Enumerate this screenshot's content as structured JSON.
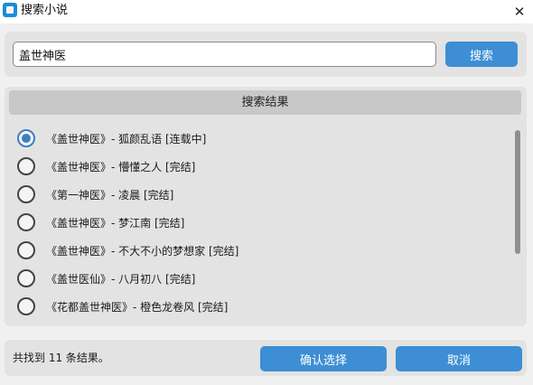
{
  "window": {
    "title": "搜索小说",
    "close_icon": "close-icon"
  },
  "search": {
    "value": "盖世神医",
    "button_label": "搜索"
  },
  "results": {
    "header": "搜索结果",
    "items": [
      {
        "label": "《盖世神医》- 狐颜乱语 [连载中]",
        "selected": true
      },
      {
        "label": "《盖世神医》- 懵懂之人 [完结]",
        "selected": false
      },
      {
        "label": "《第一神医》- 凌晨 [完结]",
        "selected": false
      },
      {
        "label": "《盖世神医》- 梦江南 [完结]",
        "selected": false
      },
      {
        "label": "《盖世神医》- 不大不小的梦想家 [完结]",
        "selected": false
      },
      {
        "label": "《盖世医仙》- 八月初八 [完结]",
        "selected": false
      },
      {
        "label": "《花都盖世神医》- 橙色龙卷风 [完结]",
        "selected": false
      }
    ]
  },
  "footer": {
    "status": "共找到 11 条结果。",
    "confirm_label": "确认选择",
    "cancel_label": "取消"
  },
  "colors": {
    "accent": "#3d8ed4",
    "panel": "#e3e3e3",
    "header": "#c8c8c8"
  }
}
